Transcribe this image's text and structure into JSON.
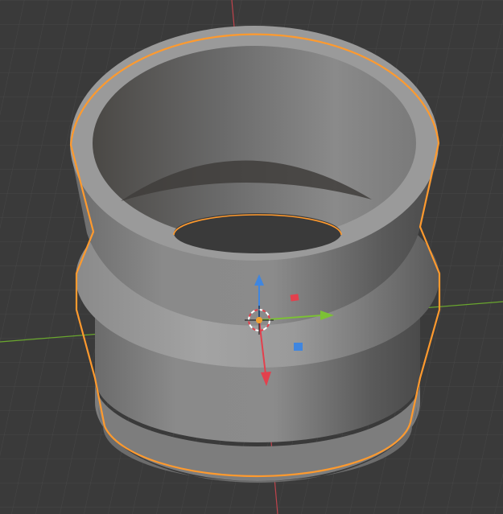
{
  "viewport": {
    "background": "#3a3a3a",
    "grid_color": "#474747",
    "grid_visible": true
  },
  "axes": {
    "x_axis_color": "#c0434c",
    "y_axis_color": "#6aa72e"
  },
  "object": {
    "shape": "stepped-cylinder-coupler",
    "selected": true,
    "outline_color": "#ff9a2e",
    "surface_color": "#8f8f8f"
  },
  "gizmo": {
    "icons": [
      "3d-cursor-icon",
      "x-axis-arrow-icon",
      "y-axis-arrow-icon",
      "z-axis-arrow-icon",
      "xz-plane-handle-icon",
      "yz-plane-handle-icon"
    ],
    "x_color": "#e3404d",
    "y_color": "#7cc135",
    "z_color": "#3f86e0"
  }
}
